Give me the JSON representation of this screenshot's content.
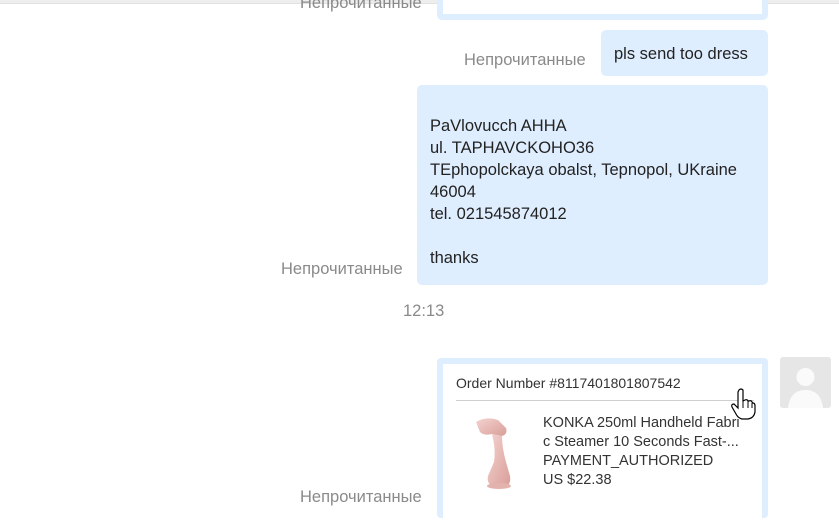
{
  "messages": [
    {
      "status": "Непрочитанные"
    },
    {
      "status": "Непрочитанные",
      "text": "pls send too dress"
    },
    {
      "status": "Непрочитанные",
      "lines": [
        "",
        "PaVlovucch AHHA",
        "ul. TAPHAVCKOHO36",
        "TEphopolckaya obalst, Tepnopol, UKraine",
        "46004",
        "tel. 021545874012",
        "",
        "thanks"
      ]
    }
  ],
  "time": "12:13",
  "order": {
    "number_label": "Order Number #8117401801807542",
    "product_line1": "KONKA 250ml Handheld Fabri",
    "product_line2": "c Steamer 10 Seconds Fast-...",
    "status": "PAYMENT_AUTHORIZED",
    "price": "US $22.38",
    "unread_status": "Непрочитанные"
  },
  "icons": {
    "avatar": "user-avatar-icon",
    "cursor": "hand-pointer-icon",
    "product": "garment-steamer-image"
  },
  "colors": {
    "bubble": "#dfeeff",
    "status_text": "#8a8a8a",
    "avatar_bg": "#e6e6e6"
  }
}
